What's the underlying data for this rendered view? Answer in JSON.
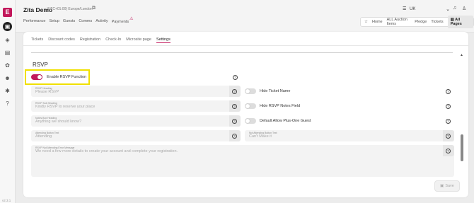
{
  "sidebar": {
    "logo": "E",
    "icons": [
      "calendar-icon",
      "layers-icon",
      "document-icon",
      "users-group-icon",
      "people-icon",
      "gear-icon",
      "help-icon"
    ],
    "version": "v2.3.1"
  },
  "header": {
    "title": "Zita Demo",
    "timezone": "(UTC+01:00) Europe/London",
    "nav": [
      "Performance",
      "Setup",
      "Guests",
      "Comms",
      "Activity",
      "Payments"
    ],
    "language": "UK",
    "quick_links": [
      "Home",
      "ALL Auction Items",
      "Pledge",
      "Tickets"
    ],
    "all_pages": "All Pages"
  },
  "tabs": [
    "Tickets",
    "Discount codes",
    "Registration",
    "Check-In",
    "Microsite page",
    "Settings"
  ],
  "active_tab": "Settings",
  "rsvp": {
    "section_title": "RSVP",
    "enable_label": "Enable RSVP Function",
    "enable_on": true,
    "fields": {
      "heading": {
        "label": "RSVP Heading",
        "placeholder": "Please RSVP"
      },
      "sub_heading": {
        "label": "RSVP Sub Heading",
        "placeholder": "Kindly RSVP to reserve your place"
      },
      "notes_box": {
        "label": "Notes Box Heading",
        "placeholder": "Anything we should know?"
      },
      "attending_btn": {
        "label": "Attending Button Text",
        "placeholder": "Attending"
      },
      "not_attending_btn": {
        "label": "Not Attending Button Text",
        "placeholder": "Can't Make it"
      },
      "not_attending_msg": {
        "label": "RSVP Not Attending Error Message",
        "placeholder": "We need a few more details to create your account and complete your registration."
      }
    },
    "toggles": {
      "hide_ticket_name": "Hide Ticket Name",
      "hide_notes_field": "Hide RSVP Notes Field",
      "allow_plus_one": "Default Allow Plus-One Guest"
    }
  },
  "save_label": "Save",
  "colors": {
    "accent": "#c2185b",
    "highlight": "#f0e000"
  }
}
